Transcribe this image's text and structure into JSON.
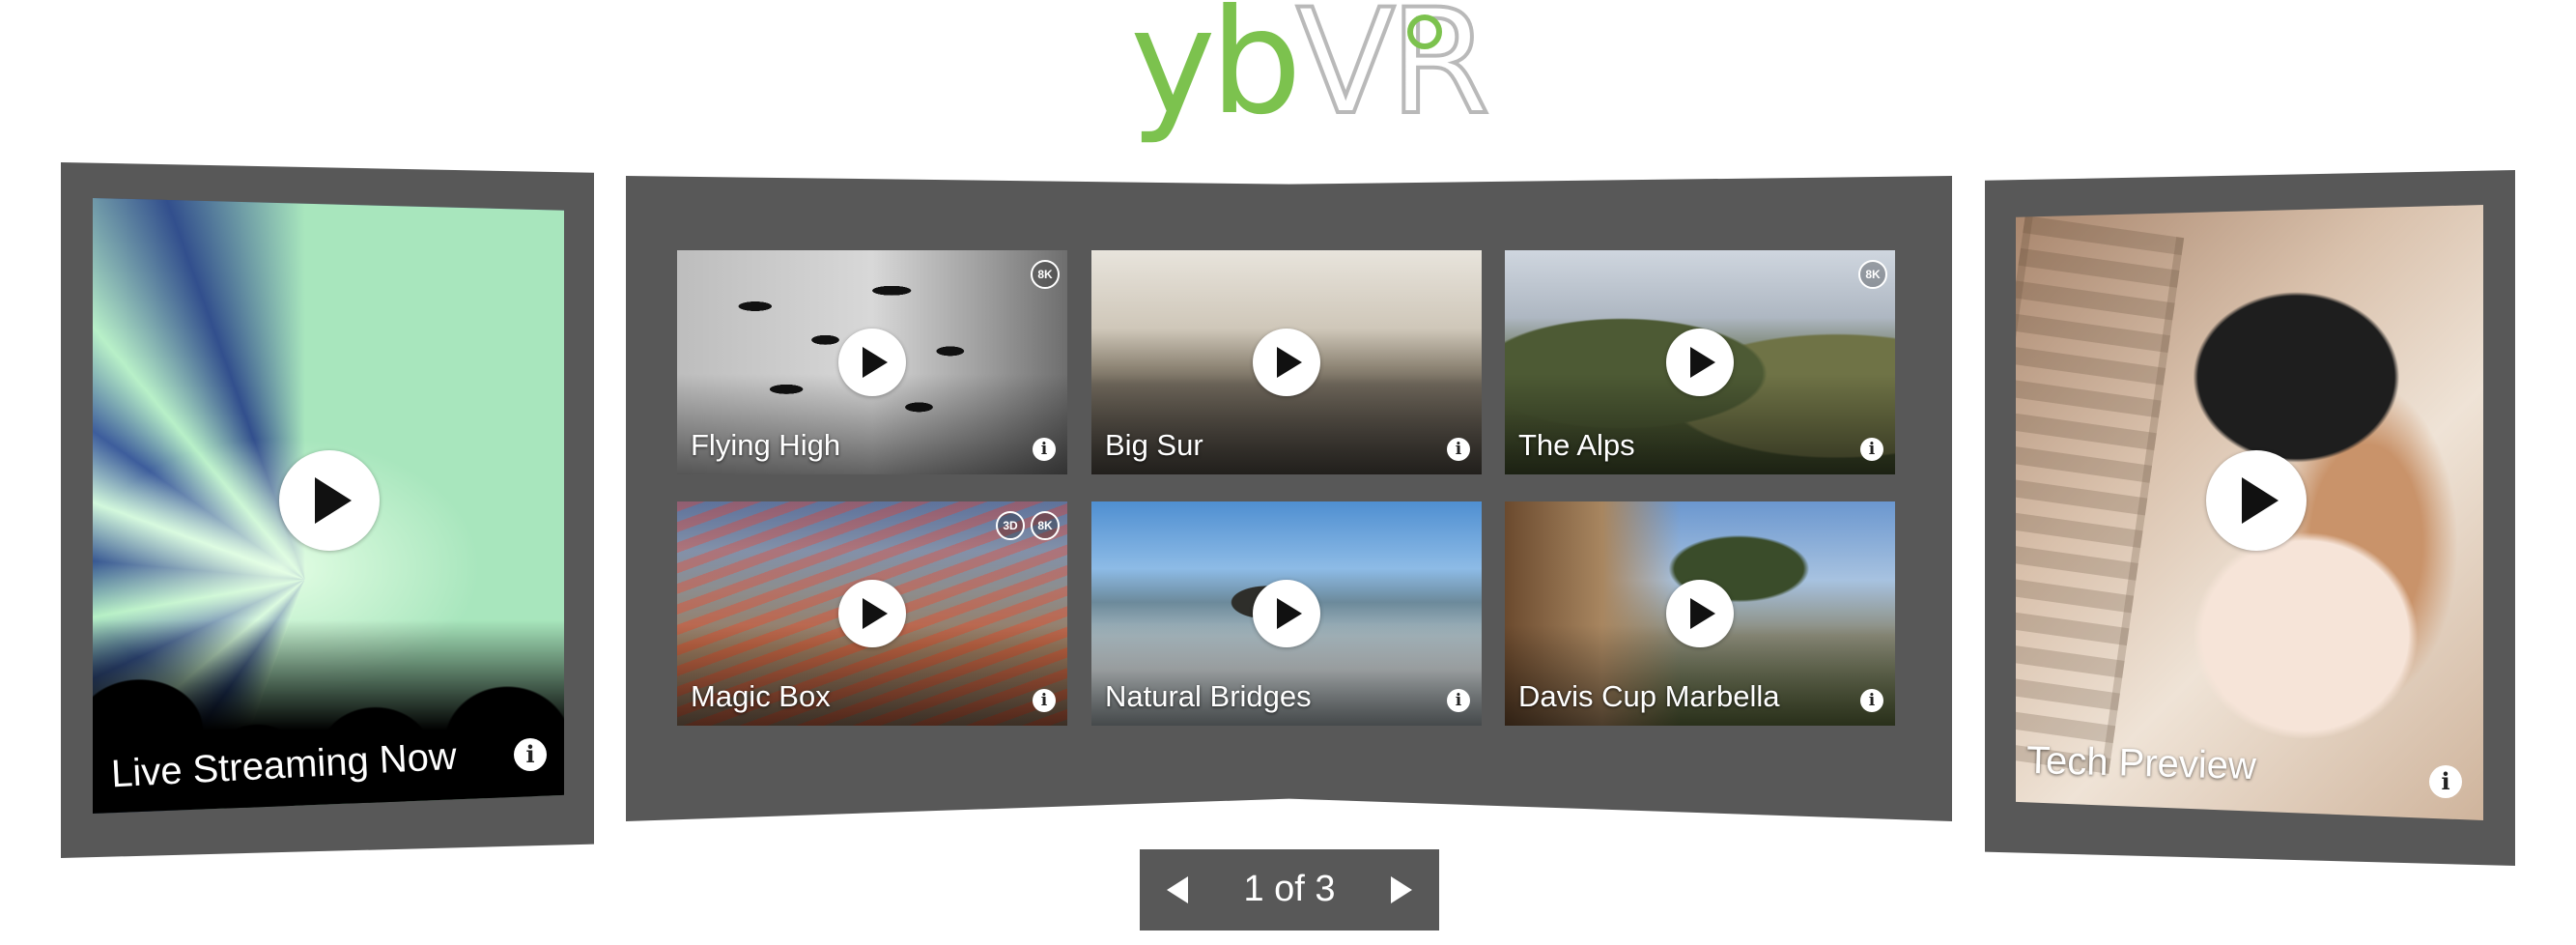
{
  "logo": {
    "yb": "yb",
    "vr": "VR"
  },
  "featured_left": {
    "title": "Live Streaming Now",
    "icon": "play-icon",
    "info_icon": "info-icon"
  },
  "featured_right": {
    "title": "Tech Preview",
    "icon": "play-icon",
    "info_icon": "info-icon"
  },
  "grid": [
    {
      "title": "Flying High",
      "badges": [
        "8K"
      ]
    },
    {
      "title": "Big Sur",
      "badges": []
    },
    {
      "title": "The Alps",
      "badges": [
        "8K"
      ]
    },
    {
      "title": "Magic Box",
      "badges": [
        "3D",
        "8K"
      ]
    },
    {
      "title": "Natural Bridges",
      "badges": []
    },
    {
      "title": "Davis Cup Marbella",
      "badges": []
    }
  ],
  "pager": {
    "label": "1 of 3",
    "prev_icon": "chevron-left-icon",
    "next_icon": "chevron-right-icon"
  },
  "colors": {
    "brand_green": "#7cc24e",
    "panel_gray": "#585858"
  }
}
